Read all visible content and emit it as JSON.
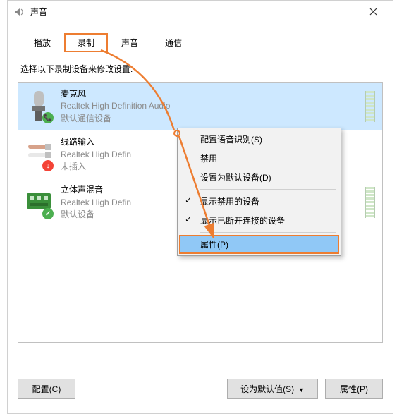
{
  "window": {
    "title": "声音"
  },
  "tabs": [
    {
      "label": "播放"
    },
    {
      "label": "录制"
    },
    {
      "label": "声音"
    },
    {
      "label": "通信"
    }
  ],
  "instruction": "选择以下录制设备来修改设置:",
  "devices": [
    {
      "name": "麦克风",
      "driver": "Realtek High Definition Audio",
      "status": "默认通信设备",
      "badge": "green"
    },
    {
      "name": "线路输入",
      "driver": "Realtek High Defin",
      "status": "未插入",
      "badge": "red"
    },
    {
      "name": "立体声混音",
      "driver": "Realtek High Defin",
      "status": "默认设备",
      "badge": "green"
    }
  ],
  "context_menu": {
    "configure": "配置语音识别(S)",
    "disable": "禁用",
    "set_default": "设置为默认设备(D)",
    "show_disabled": "显示禁用的设备",
    "show_disconnected": "显示已断开连接的设备",
    "properties": "属性(P)"
  },
  "buttons": {
    "configure": "配置(C)",
    "set_default": "设为默认值(S)",
    "properties": "属性(P)"
  },
  "badge_glyphs": {
    "green": "📞",
    "red": "↓"
  }
}
